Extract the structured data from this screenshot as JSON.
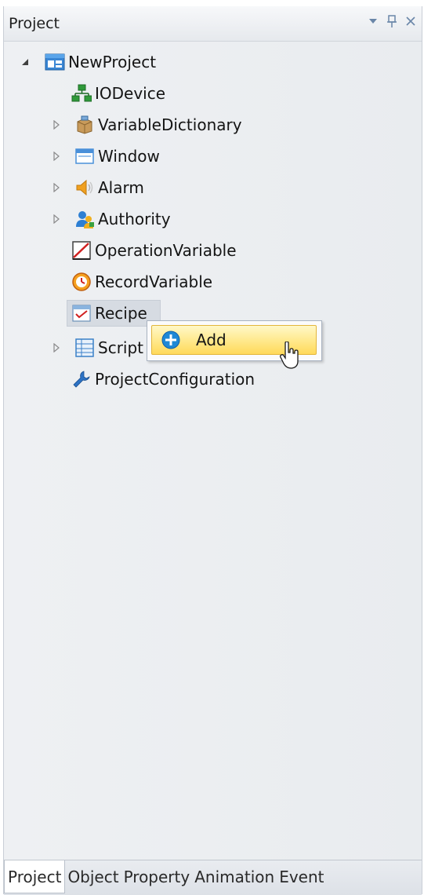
{
  "panel": {
    "title": "Project",
    "controls": {
      "dropdown": "▾",
      "pin": "⊥",
      "close": "×"
    }
  },
  "tree": {
    "root": {
      "label": "NewProject",
      "expanded": true,
      "icon": "project-window-icon"
    },
    "children": [
      {
        "label": "IODevice",
        "has_children": false,
        "icon": "network-icon"
      },
      {
        "label": "VariableDictionary",
        "has_children": true,
        "icon": "box-icon"
      },
      {
        "label": "Window",
        "has_children": true,
        "icon": "window-icon"
      },
      {
        "label": "Alarm",
        "has_children": true,
        "icon": "speaker-icon"
      },
      {
        "label": "Authority",
        "has_children": true,
        "icon": "users-icon"
      },
      {
        "label": "OperationVariable",
        "has_children": false,
        "icon": "chart-line-icon"
      },
      {
        "label": "RecordVariable",
        "has_children": false,
        "icon": "clock-icon"
      },
      {
        "label": "Recipe",
        "has_children": false,
        "icon": "recipe-icon",
        "selected": true
      },
      {
        "label": "Script",
        "has_children": true,
        "icon": "script-icon"
      },
      {
        "label": "ProjectConfiguration",
        "has_children": false,
        "icon": "wrench-icon"
      }
    ]
  },
  "context_menu": {
    "items": [
      {
        "label": "Add",
        "icon": "plus-circle-icon",
        "highlighted": true
      }
    ]
  },
  "bottom_tabs": [
    {
      "label": "Project",
      "active": true
    },
    {
      "label": "Object",
      "active": false
    },
    {
      "label": "Property",
      "active": false
    },
    {
      "label": "Animation",
      "active": false
    },
    {
      "label": "Event",
      "active": false
    }
  ],
  "colors": {
    "menu_highlight": "#ffe88a",
    "selection": "#d6dbe2",
    "add_icon": "#1e88d6"
  }
}
